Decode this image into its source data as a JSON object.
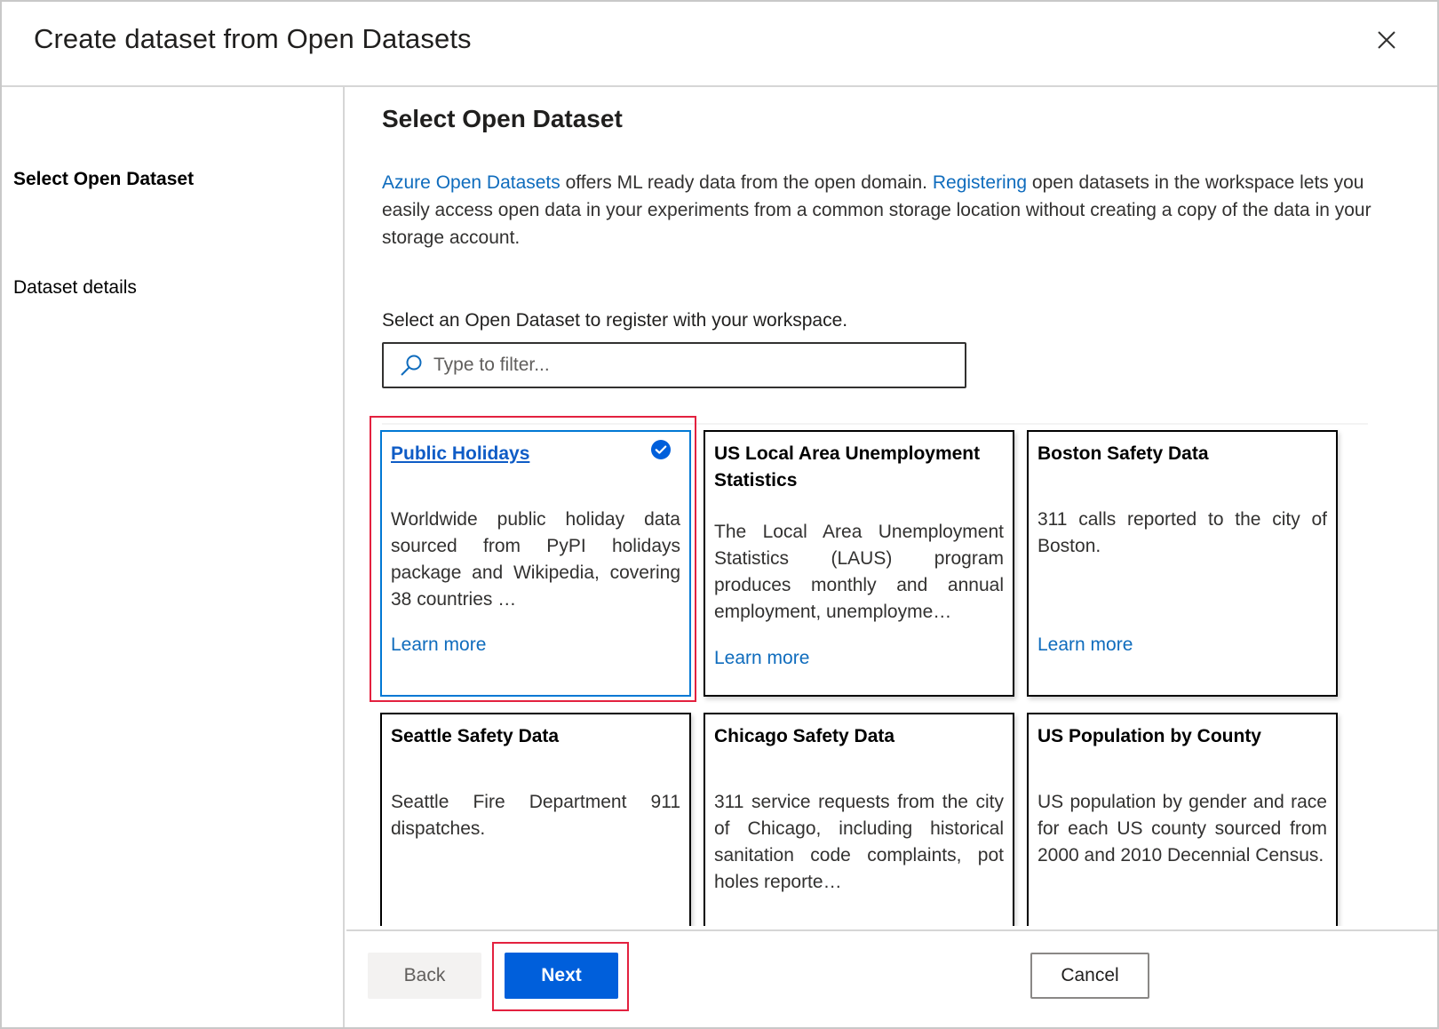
{
  "dialog": {
    "title": "Create dataset from Open Datasets",
    "close_icon": "close-icon"
  },
  "sidebar": {
    "steps": [
      {
        "label": "Select Open Dataset",
        "active": true
      },
      {
        "label": "Dataset details",
        "active": false
      }
    ]
  },
  "main": {
    "section_title": "Select Open Dataset",
    "intro": {
      "link1": "Azure Open Datasets",
      "text1": " offers ML ready data from the open domain. ",
      "link2": "Registering",
      "text2": " open datasets in the workspace lets you easily access open data in your experiments from a common storage location without creating a copy of the data in your storage account."
    },
    "filter": {
      "label": "Select an Open Dataset to register with your workspace.",
      "placeholder": "Type to filter...",
      "value": "",
      "icon": "search-icon"
    },
    "datasets": [
      {
        "title": "Public Holidays",
        "description": "Worldwide public holiday data sourced from PyPI holidays package and Wikipedia, covering 38 countries …",
        "learn_more": "Learn more",
        "selected": true
      },
      {
        "title": "US Local Area Unemployment Statistics",
        "description": "The Local Area Unemployment Statistics (LAUS) program produces monthly and annual employment, unemployme…",
        "learn_more": "Learn more",
        "selected": false
      },
      {
        "title": "Boston Safety Data",
        "description": "311 calls reported to the city of Boston.",
        "learn_more": "Learn more",
        "selected": false
      },
      {
        "title": "Seattle Safety Data",
        "description": "Seattle Fire Department 911 dispatches.",
        "learn_more": "",
        "selected": false
      },
      {
        "title": "Chicago Safety Data",
        "description": "311 service requests from the city of Chicago, including historical sanitation code complaints, pot holes reporte…",
        "learn_more": "",
        "selected": false
      },
      {
        "title": "US Population by County",
        "description": "US population by gender and race for each US county sourced from 2000 and 2010 Decennial Census.",
        "learn_more": "",
        "selected": false
      }
    ]
  },
  "footer": {
    "back_label": "Back",
    "next_label": "Next",
    "cancel_label": "Cancel"
  },
  "colors": {
    "accent": "#005fdb",
    "link": "#0f6cbd",
    "selected_border": "#0078d4",
    "highlight_outline": "#e3213f"
  }
}
